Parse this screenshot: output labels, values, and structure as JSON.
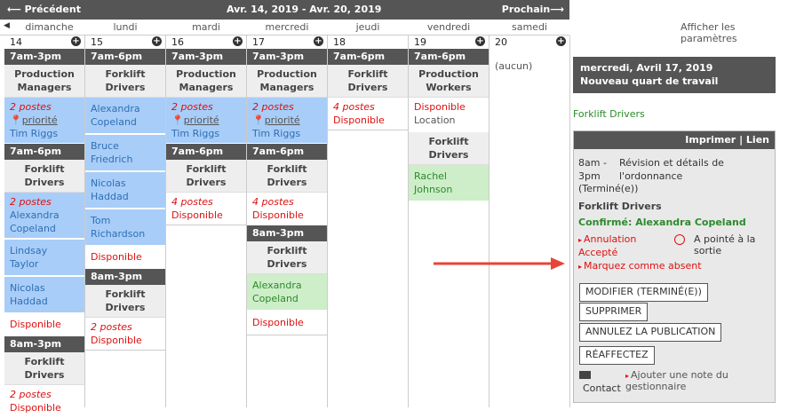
{
  "nav": {
    "prev": "⟵ Précédent",
    "range": "Avr. 14, 2019 - Avr. 20, 2019",
    "next": "Prochain⟶"
  },
  "days": [
    "dimanche",
    "lundi",
    "mardi",
    "mercredi",
    "jeudi",
    "vendredi",
    "samedi"
  ],
  "dates": [
    "14",
    "15",
    "16",
    "17",
    "18",
    "19",
    "20"
  ],
  "sun": {
    "t1": "7am-3pm",
    "r1": "Production Managers",
    "req1": "2 postes",
    "pri1": "priorité",
    "n1": "Tim Riggs",
    "t2": "7am-6pm",
    "r2": "Forklift Drivers",
    "req2": "2 postes",
    "n2": "Alexandra Copeland",
    "n3": "Lindsay Taylor",
    "n4": "Nicolas Haddad",
    "d2": "Disponible",
    "t3": "8am-3pm",
    "r3": "Forklift Drivers",
    "req3": "2 postes",
    "d3": "Disponible"
  },
  "mon": {
    "t1": "7am-6pm",
    "r1": "Forklift Drivers",
    "n1": "Alexandra Copeland",
    "n2": "Bruce Friedrich",
    "n3": "Nicolas Haddad",
    "n4": "Tom Richardson",
    "d1": "Disponible",
    "t2": "8am-3pm",
    "r2": "Forklift Drivers",
    "req2": "2 postes",
    "d2": "Disponible"
  },
  "tue": {
    "t1": "7am-3pm",
    "r1": "Production Managers",
    "req1": "2 postes",
    "pri1": "priorité",
    "n1": "Tim Riggs",
    "t2": "7am-6pm",
    "r2": "Forklift Drivers",
    "req2": "4 postes",
    "d2": "Disponible"
  },
  "wed": {
    "t1": "7am-3pm",
    "r1": "Production Managers",
    "req1": "2 postes",
    "pri1": "priorité",
    "n1": "Tim Riggs",
    "t2": "7am-6pm",
    "r2": "Forklift Drivers",
    "req2": "4 postes",
    "d2": "Disponible",
    "t3": "8am-3pm",
    "r3": "Forklift Drivers",
    "n3": "Alexandra Copeland",
    "d3": "Disponible"
  },
  "thu": {
    "t1": "7am-6pm",
    "r1": "Forklift Drivers",
    "req1": "4 postes",
    "d1": "Disponible"
  },
  "fri": {
    "t1": "7am-6pm",
    "r1": "Production Workers",
    "d1": "Disponible",
    "loc1": "Location",
    "r2": "Forklift Drivers",
    "n2": "Rachel Johnson"
  },
  "sat": {
    "none": "(aucun)"
  },
  "settings": "Afficher les paramètres",
  "panel": {
    "date": "mercredi, Avril 17, 2019",
    "subtitle": "Nouveau quart de travail",
    "role": "Forklift Drivers",
    "print": "Imprimer | Lien",
    "time": "8am - 3pm",
    "review": "Révision et détails de l'ordonnance",
    "status": "(Terminé(e))",
    "drole": "Forklift Drivers",
    "confirmed": "Confirmé: Alexandra Copeland",
    "cancel": "Annulation",
    "accepted": "Accepté",
    "clockout": "A pointé à la sortie",
    "absent": "Marquez comme absent",
    "b_modify": "MODIFIER (TERMINÉ(E))",
    "b_delete": "SUPPRIMER",
    "b_unpublish": "ANNULEZ LA PUBLICATION",
    "b_reassign": "RÉAFFECTEZ",
    "contact": "Contact",
    "addnote": "Ajouter une note du gestionnaire"
  }
}
